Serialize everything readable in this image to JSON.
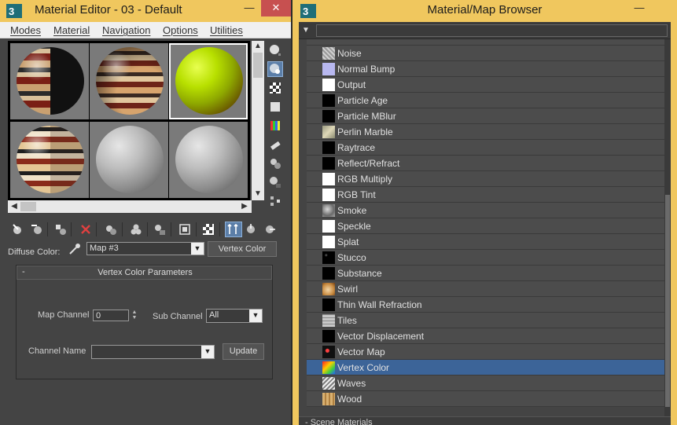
{
  "material_editor": {
    "title": "Material Editor - 03 - Default",
    "window_buttons": {
      "minimize": "—",
      "close": "✕"
    },
    "menu": [
      "Modes",
      "Material",
      "Navigation",
      "Options",
      "Utilities"
    ],
    "diffuse_label": "Diffuse Color:",
    "map_combo_value": "Map #3",
    "vertex_color_button": "Vertex Color",
    "rollout": {
      "title": "Vertex Color Parameters",
      "collapse_symbol": "-",
      "map_channel_label": "Map Channel",
      "map_channel_value": "0",
      "sub_channel_label": "Sub Channel",
      "sub_channel_value": "All",
      "channel_name_label": "Channel Name",
      "channel_name_value": "",
      "update_button": "Update"
    }
  },
  "browser": {
    "title": "Material/Map Browser",
    "window_buttons": {
      "minimize": "—"
    },
    "search_value": "",
    "items": [
      {
        "name": "Noise",
        "icon": "noise-swatch"
      },
      {
        "name": "Normal Bump",
        "icon": "normal-bump-swatch"
      },
      {
        "name": "Output",
        "icon": "white-swatch"
      },
      {
        "name": "Particle Age",
        "icon": "black-swatch"
      },
      {
        "name": "Particle MBlur",
        "icon": "black-swatch"
      },
      {
        "name": "Perlin Marble",
        "icon": "marble-swatch"
      },
      {
        "name": "Raytrace",
        "icon": "black-swatch"
      },
      {
        "name": "Reflect/Refract",
        "icon": "black-swatch"
      },
      {
        "name": "RGB Multiply",
        "icon": "white-swatch"
      },
      {
        "name": "RGB Tint",
        "icon": "white-swatch"
      },
      {
        "name": "Smoke",
        "icon": "smoke-swatch"
      },
      {
        "name": "Speckle",
        "icon": "white-swatch"
      },
      {
        "name": "Splat",
        "icon": "white-swatch"
      },
      {
        "name": "Stucco",
        "icon": "stucco-swatch"
      },
      {
        "name": "Substance",
        "icon": "black-swatch"
      },
      {
        "name": "Swirl",
        "icon": "swirl-swatch"
      },
      {
        "name": "Thin Wall Refraction",
        "icon": "black-swatch"
      },
      {
        "name": "Tiles",
        "icon": "tiles-swatch"
      },
      {
        "name": "Vector Displacement",
        "icon": "black-swatch"
      },
      {
        "name": "Vector Map",
        "icon": "vector-map-swatch"
      },
      {
        "name": "Vertex Color",
        "icon": "vertex-color-swatch"
      },
      {
        "name": "Waves",
        "icon": "waves-swatch"
      },
      {
        "name": "Wood",
        "icon": "wood-swatch"
      }
    ],
    "selected_item": "Vertex Color",
    "scene_materials_label": "- Scene Materials",
    "colors": {
      "selection": "#3c6498",
      "title_bar": "#f0c75e"
    }
  }
}
